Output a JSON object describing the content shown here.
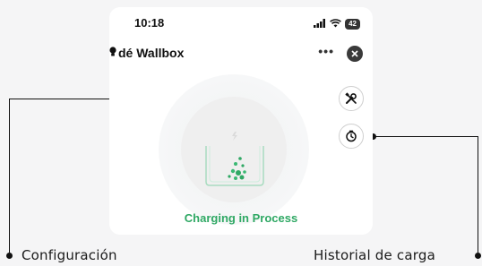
{
  "status_bar": {
    "time": "10:18",
    "battery": "42"
  },
  "header": {
    "title": "dé Wallbox",
    "more_label": "•••"
  },
  "main": {
    "status_text": "Charging in Process"
  },
  "callouts": {
    "left_label": "Configuración",
    "right_label": "Historial de carga"
  },
  "colors": {
    "accent": "#2fa864",
    "close_button": "#3a3a3a"
  },
  "icons": {
    "settings": "wrench-screwdriver-icon",
    "history": "timer-icon",
    "close": "close-icon",
    "more": "more-dots-icon"
  }
}
